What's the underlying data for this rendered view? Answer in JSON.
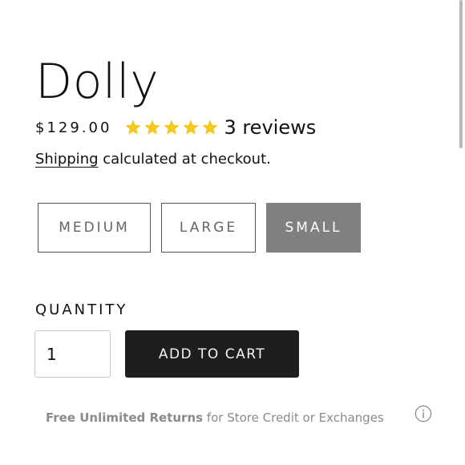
{
  "product": {
    "title": "Dolly",
    "price": "$129.00",
    "rating": 5,
    "rating_max": 5,
    "reviews_text": "3 reviews"
  },
  "shipping": {
    "link_text": "Shipping",
    "rest_text": " calculated at checkout."
  },
  "variants": {
    "items": [
      {
        "label": "MEDIUM",
        "selected": false
      },
      {
        "label": "LARGE",
        "selected": false
      },
      {
        "label": "SMALL",
        "selected": true
      }
    ]
  },
  "quantity": {
    "label": "QUANTITY",
    "value": "1"
  },
  "cart": {
    "button_label": "ADD TO CART"
  },
  "returns": {
    "strong_text": "Free Unlimited Returns",
    "rest_text": " for Store Credit or Exchanges"
  },
  "icons": {
    "star": "star-icon",
    "info": "info-icon"
  },
  "colors": {
    "star": "#f5c81c",
    "selected_variant_bg": "#808080",
    "cart_button_bg": "#1e1e1e"
  }
}
